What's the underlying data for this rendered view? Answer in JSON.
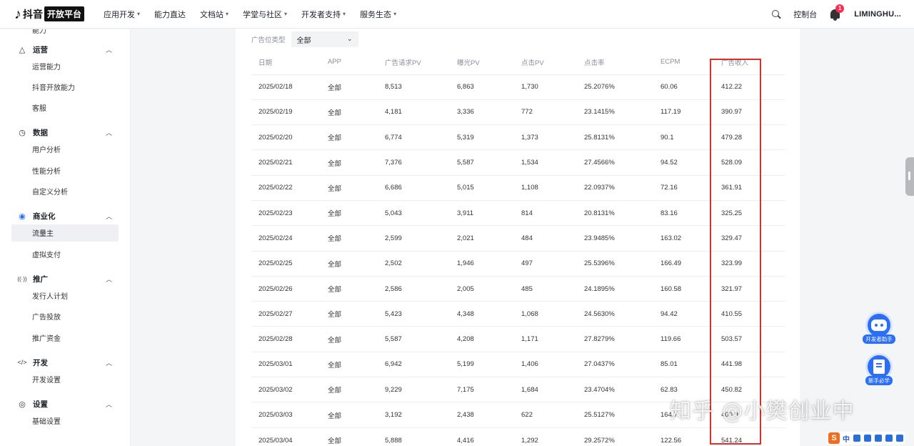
{
  "header": {
    "logo_mark": "♪",
    "logo_text": "抖音",
    "logo_badge": "开放平台",
    "nav": [
      {
        "label": "应用开发",
        "has_menu": true
      },
      {
        "label": "能力直达",
        "has_menu": false
      },
      {
        "label": "文档站",
        "has_menu": true
      },
      {
        "label": "学堂与社区",
        "has_menu": true
      },
      {
        "label": "开发者支持",
        "has_menu": true
      },
      {
        "label": "服务生态",
        "has_menu": true
      }
    ],
    "console": "控制台",
    "notification_count": "1",
    "username": "LIMINGHU..."
  },
  "sidebar": {
    "cut_item": "能力",
    "groups": [
      {
        "icon": "operation-icon",
        "title": "运营",
        "items": [
          "运营能力",
          "抖音开放能力",
          "客服"
        ]
      },
      {
        "icon": "clock-icon",
        "title": "数据",
        "items": [
          "用户分析",
          "性能分析",
          "自定义分析"
        ]
      },
      {
        "icon": "commerce-icon",
        "title": "商业化",
        "items": [
          "流量主",
          "虚拟支付"
        ]
      },
      {
        "icon": "broadcast-icon",
        "title": "推广",
        "items": [
          "发行人计划",
          "广告投放",
          "推广资金"
        ]
      },
      {
        "icon": "code-icon",
        "title": "开发",
        "items": [
          "开发设置"
        ]
      },
      {
        "icon": "gear-icon",
        "title": "设置",
        "items": [
          "基础设置"
        ]
      }
    ],
    "active_item": "流量主"
  },
  "filter": {
    "label": "广告位类型",
    "value": "全部"
  },
  "table": {
    "columns": [
      "日期",
      "APP",
      "广告请求PV",
      "曝光PV",
      "点击PV",
      "点击率",
      "ECPM",
      "广告收入"
    ],
    "rows": [
      [
        "2025/02/18",
        "全部",
        "8,513",
        "6,863",
        "1,730",
        "25.2076%",
        "60.06",
        "412.22"
      ],
      [
        "2025/02/19",
        "全部",
        "4,181",
        "3,336",
        "772",
        "23.1415%",
        "117.19",
        "390.97"
      ],
      [
        "2025/02/20",
        "全部",
        "6,774",
        "5,319",
        "1,373",
        "25.8131%",
        "90.1",
        "479.28"
      ],
      [
        "2025/02/21",
        "全部",
        "7,376",
        "5,587",
        "1,534",
        "27.4566%",
        "94.52",
        "528.09"
      ],
      [
        "2025/02/22",
        "全部",
        "6,686",
        "5,015",
        "1,108",
        "22.0937%",
        "72.16",
        "361.91"
      ],
      [
        "2025/02/23",
        "全部",
        "5,043",
        "3,911",
        "814",
        "20.8131%",
        "83.16",
        "325.25"
      ],
      [
        "2025/02/24",
        "全部",
        "2,599",
        "2,021",
        "484",
        "23.9485%",
        "163.02",
        "329.47"
      ],
      [
        "2025/02/25",
        "全部",
        "2,502",
        "1,946",
        "497",
        "25.5396%",
        "166.49",
        "323.99"
      ],
      [
        "2025/02/26",
        "全部",
        "2,586",
        "2,005",
        "485",
        "24.1895%",
        "160.58",
        "321.97"
      ],
      [
        "2025/02/27",
        "全部",
        "5,423",
        "4,348",
        "1,068",
        "24.5630%",
        "94.42",
        "410.55"
      ],
      [
        "2025/02/28",
        "全部",
        "5,587",
        "4,208",
        "1,171",
        "27.8279%",
        "119.66",
        "503.57"
      ],
      [
        "2025/03/01",
        "全部",
        "6,942",
        "5,199",
        "1,406",
        "27.0437%",
        "85.01",
        "441.98"
      ],
      [
        "2025/03/02",
        "全部",
        "9,229",
        "7,175",
        "1,684",
        "23.4704%",
        "62.83",
        "450.82"
      ],
      [
        "2025/03/03",
        "全部",
        "3,192",
        "2,438",
        "622",
        "25.5127%",
        "164.7",
        "400.9"
      ],
      [
        "2025/03/04",
        "全部",
        "5,888",
        "4,416",
        "1,292",
        "29.2572%",
        "122.56",
        "541.24"
      ]
    ]
  },
  "helpers": [
    {
      "label": "开发者助手",
      "icon": "robot-icon"
    },
    {
      "label": "新手必学",
      "icon": "book-icon"
    }
  ],
  "watermark": "知乎 @小樊创业中",
  "ime": {
    "logo": "S",
    "mode": "中"
  },
  "colors": {
    "highlight": "#d8302f",
    "accent": "#2a6ff5",
    "brand_red": "#fe2c55"
  }
}
